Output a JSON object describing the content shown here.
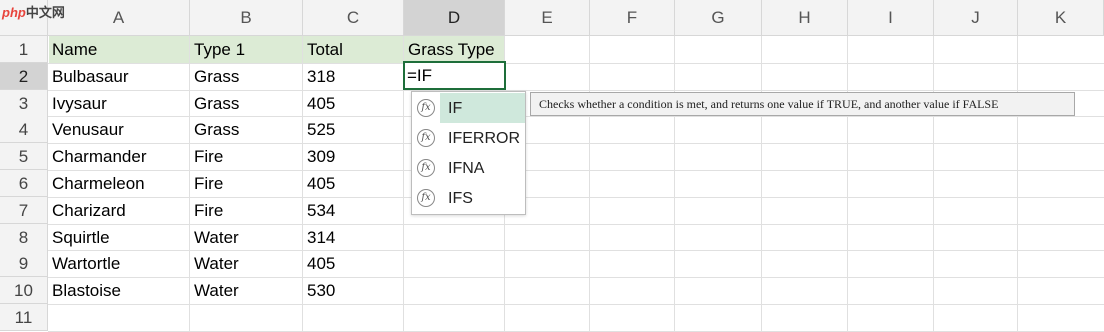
{
  "watermark": {
    "brand": "php",
    "site": "中文网"
  },
  "columns": [
    "A",
    "B",
    "C",
    "D",
    "E",
    "F",
    "G",
    "H",
    "I",
    "J",
    "K"
  ],
  "selected_column": "D",
  "rows": [
    "1",
    "2",
    "3",
    "4",
    "5",
    "6",
    "7",
    "8",
    "9",
    "10",
    "11"
  ],
  "selected_row": "2",
  "header_row": [
    "Name",
    "Type 1",
    "Total",
    "Grass Type"
  ],
  "data_rows": [
    [
      "Bulbasaur",
      "Grass",
      "318"
    ],
    [
      "Ivysaur",
      "Grass",
      "405"
    ],
    [
      "Venusaur",
      "Grass",
      "525"
    ],
    [
      "Charmander",
      "Fire",
      "309"
    ],
    [
      "Charmeleon",
      "Fire",
      "405"
    ],
    [
      "Charizard",
      "Fire",
      "534"
    ],
    [
      "Squirtle",
      "Water",
      "314"
    ],
    [
      "Wartortle",
      "Water",
      "405"
    ],
    [
      "Blastoise",
      "Water",
      "530"
    ]
  ],
  "active_cell": {
    "ref": "D2",
    "value": "=IF"
  },
  "autocomplete": {
    "items": [
      "IF",
      "IFERROR",
      "IFNA",
      "IFS"
    ],
    "highlighted": "IF",
    "tooltip": "Checks whether a condition is met, and returns one value if TRUE, and another value if FALSE"
  },
  "colors": {
    "header_fill": "#dcebd5",
    "active_border": "#1e6e3a",
    "highlight": "#cfe8dc"
  }
}
